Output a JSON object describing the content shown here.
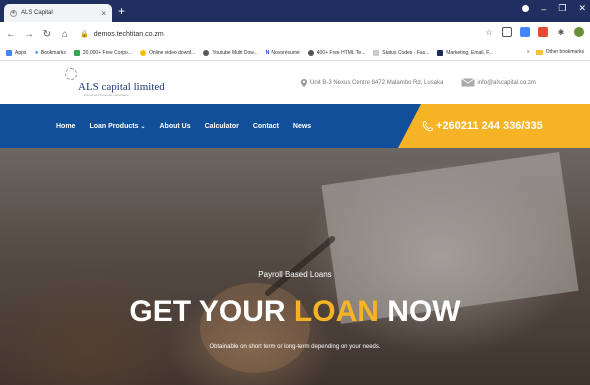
{
  "browser": {
    "tab_title": "ALS Capital",
    "tab_close": "×",
    "new_tab": "+",
    "url": "demos.techtitan.co.zm",
    "bookmarks": [
      {
        "label": "Apps",
        "color": "#4285f4"
      },
      {
        "label": "Bookmarks",
        "color": "#1a73e8"
      },
      {
        "label": "20,000+ Free Corpo...",
        "color": "#34a853"
      },
      {
        "label": "Online video downl...",
        "color": "#fbbc05"
      },
      {
        "label": "Youtube Multi Dow...",
        "color": "#555555"
      },
      {
        "label": "Novorésumé",
        "color": "#1a3cc8"
      },
      {
        "label": "400+ Free HTML Te...",
        "color": "#555555"
      },
      {
        "label": "Status Codes - Fas...",
        "color": "#cccccc"
      },
      {
        "label": "Marketing, Email, F...",
        "color": "#1c2b5a"
      }
    ],
    "bookmarks_more": "»",
    "other_bookmarks": "Other bookmarks"
  },
  "site": {
    "logo_text": "ALS capital limited",
    "logo_sub": "Payroll and Financial Consultants",
    "address": "Unit B-3 Nexus Centre 8472 Malambo Rd, Lusaka",
    "email": "info@alscapital.co.zm",
    "nav": {
      "home": "Home",
      "loan_products": "Loan Products",
      "about": "About Us",
      "calculator": "Calculator",
      "contact": "Contact",
      "news": "News"
    },
    "phone": "+260211 244 336/335"
  },
  "hero": {
    "subtitle": "Payroll Based Loans",
    "title_part1": "GET YOUR ",
    "title_accent": "LOAN",
    "title_part2": " NOW",
    "description": "Obtainable on short term or long-term depending on your needs."
  },
  "colors": {
    "nav_blue": "#10509a",
    "accent_yellow": "#f5b325",
    "tab_bar": "#202f60"
  }
}
